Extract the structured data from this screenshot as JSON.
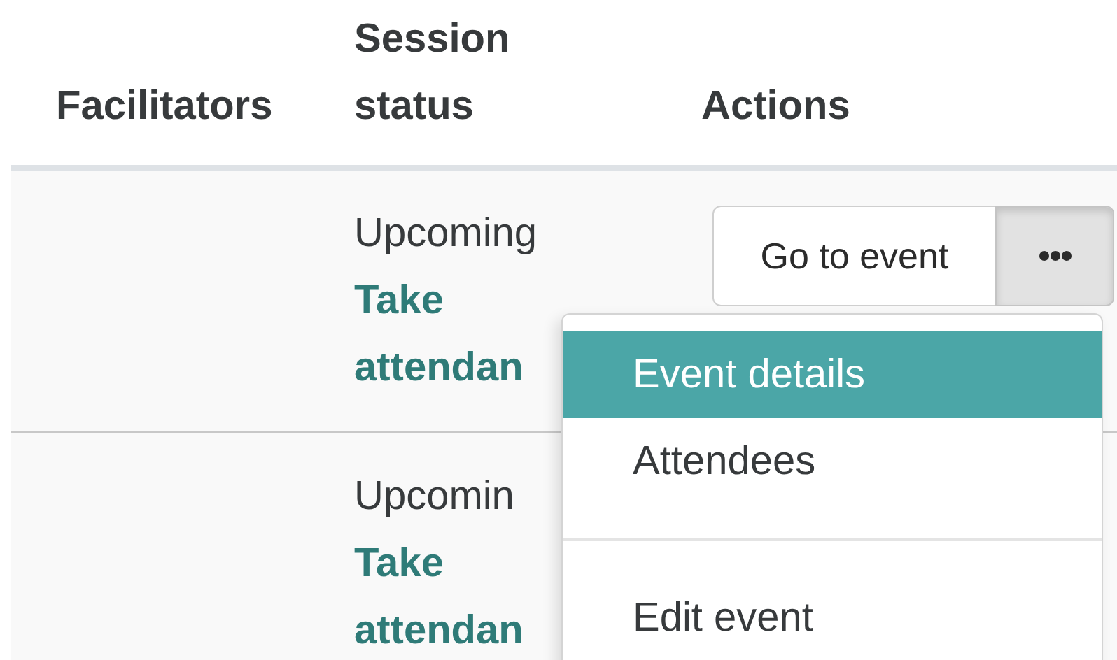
{
  "table": {
    "columns": [
      "Facilitators",
      "Session status",
      "Actions"
    ],
    "rows": [
      {
        "status": "Upcoming",
        "link": "Take attendan",
        "actions": {
          "button": "Go to event",
          "toggle_pressed": true
        }
      },
      {
        "status": "Upcomin",
        "link": "Take attendan"
      }
    ]
  },
  "menu": {
    "items": [
      {
        "kind": "item",
        "label": "Event details",
        "selected": true
      },
      {
        "kind": "item",
        "label": "Attendees",
        "selected": false
      },
      {
        "kind": "divider"
      },
      {
        "kind": "item",
        "label": "Edit event",
        "selected": false
      }
    ]
  }
}
